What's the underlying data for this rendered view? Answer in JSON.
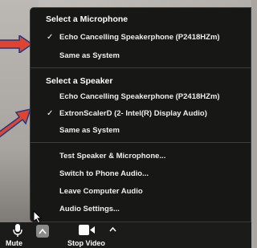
{
  "menu": {
    "microphone": {
      "title": "Select a Microphone",
      "items": [
        {
          "label": "Echo Cancelling Speakerphone (P2418HZm)",
          "checked": true
        },
        {
          "label": "Same as System",
          "checked": false
        }
      ]
    },
    "speaker": {
      "title": "Select a Speaker",
      "items": [
        {
          "label": "Echo Cancelling Speakerphone (P2418HZm)",
          "checked": false
        },
        {
          "label": "ExtronScalerD (2- Intel(R) Display Audio)",
          "checked": true
        },
        {
          "label": "Same as System",
          "checked": false
        }
      ]
    },
    "actions": [
      {
        "label": "Test Speaker & Microphone..."
      },
      {
        "label": "Switch to Phone Audio..."
      },
      {
        "label": "Leave Computer Audio"
      },
      {
        "label": "Audio Settings..."
      }
    ],
    "check_glyph": "✓"
  },
  "toolbar": {
    "mute_label": "Mute",
    "stop_video_label": "Stop Video"
  },
  "colors": {
    "menu_bg": "#171716",
    "arrow": "#e0442e",
    "toolbar_bg": "#1b1b1a"
  }
}
